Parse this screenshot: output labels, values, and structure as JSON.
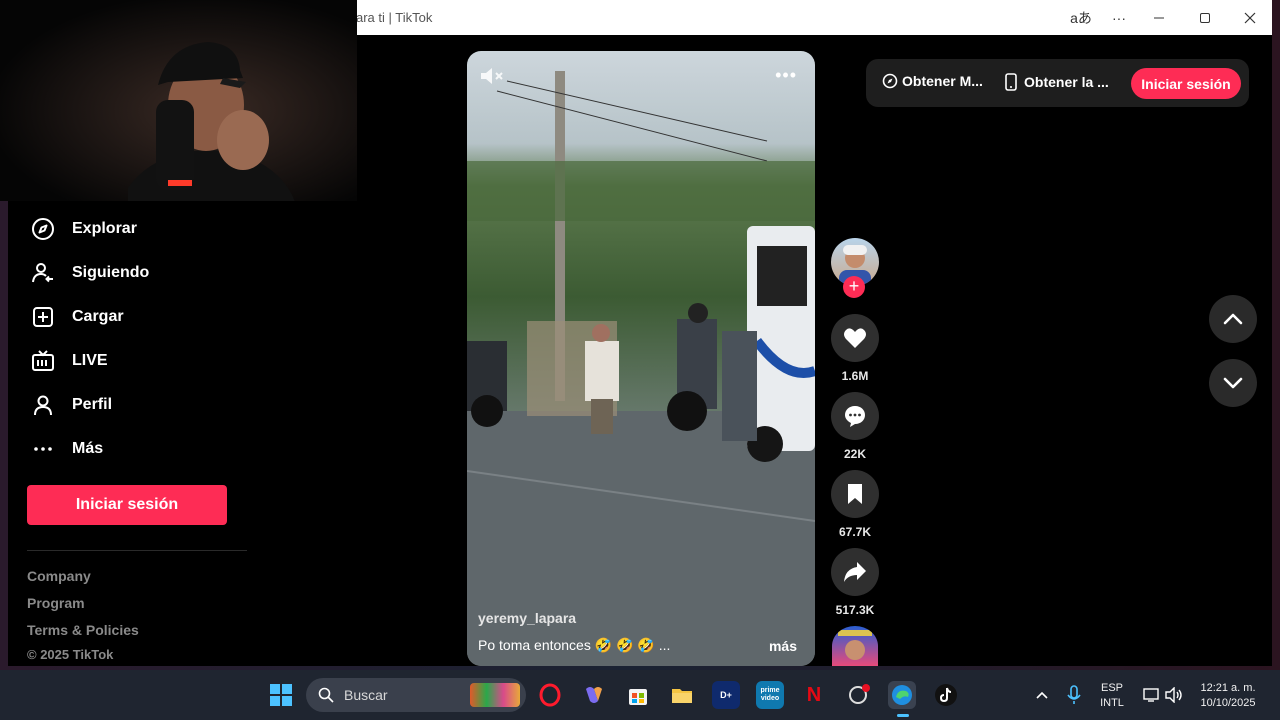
{
  "window": {
    "title": "ara ti | TikTok",
    "translate_icon": "aあ",
    "more": "···"
  },
  "sidebar": {
    "items": [
      {
        "label": "Explorar",
        "icon": "compass-icon"
      },
      {
        "label": "Siguiendo",
        "icon": "following-icon"
      },
      {
        "label": "Cargar",
        "icon": "upload-icon"
      },
      {
        "label": "LIVE",
        "icon": "live-icon"
      },
      {
        "label": "Perfil",
        "icon": "person-icon"
      },
      {
        "label": "Más",
        "icon": "more-icon"
      }
    ],
    "login_label": "Iniciar sesión",
    "footer": {
      "company": "Company",
      "program": "Program",
      "terms": "Terms & Policies",
      "copyright": "© 2025 TikTok"
    }
  },
  "video": {
    "username": "yeremy_lapara",
    "caption": "Po toma entonces 🤣 🤣 🤣 ...",
    "more_label": "más"
  },
  "actions": {
    "likes": "1.6M",
    "comments": "22K",
    "saves": "67.7K",
    "shares": "517.3K"
  },
  "topbar": {
    "get_app": "Obtener M...",
    "get_mobile": "Obtener la ...",
    "login": "Iniciar sesión"
  },
  "taskbar": {
    "search_placeholder": "Buscar",
    "lang_top": "ESP",
    "lang_bottom": "INTL",
    "time": "12:21 a. m.",
    "date": "10/10/2025",
    "prime_label": "prime video"
  },
  "colors": {
    "accent": "#fe2c55",
    "background": "#000000",
    "taskbar": "#1f2530"
  }
}
